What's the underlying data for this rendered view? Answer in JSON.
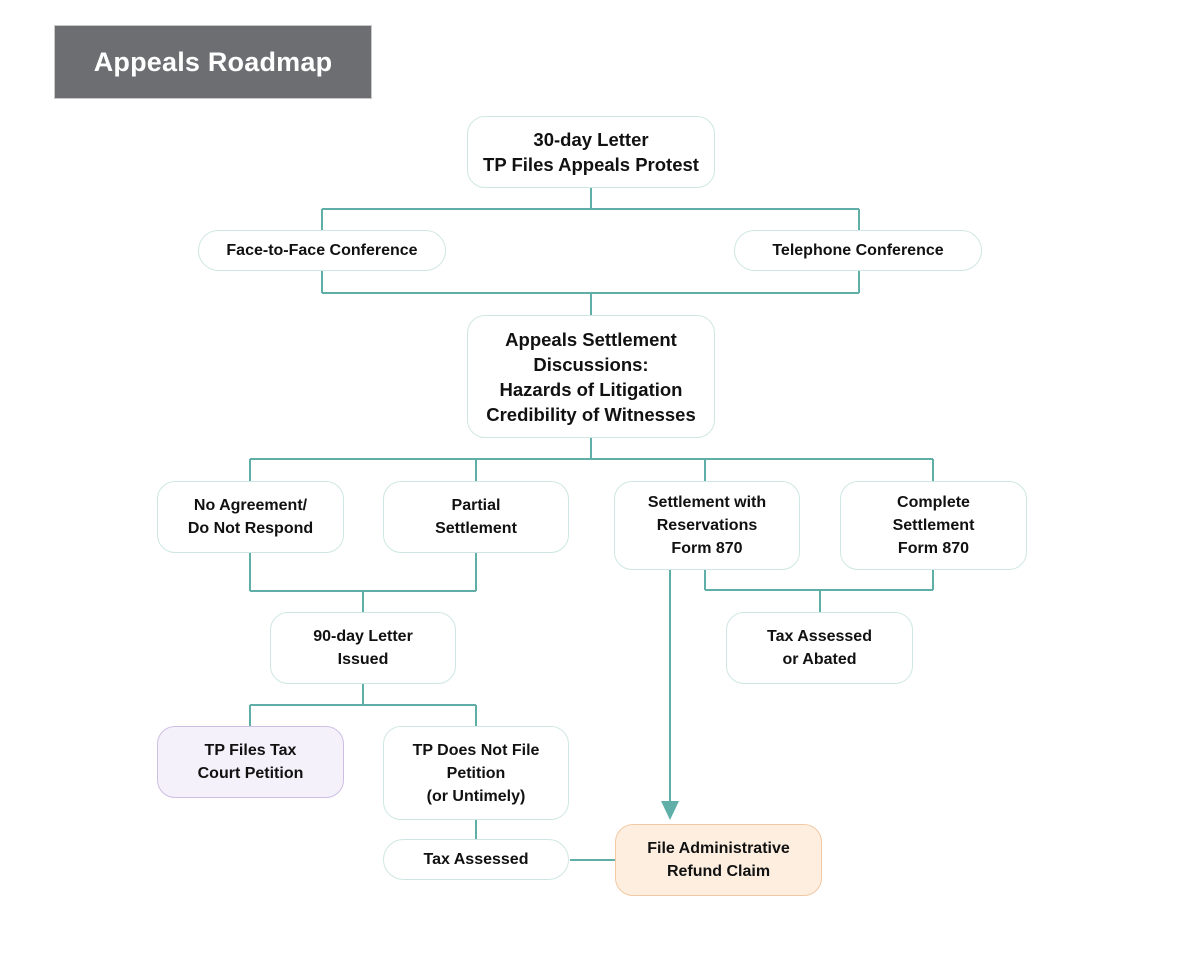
{
  "title": "Appeals Roadmap",
  "colors": {
    "connector": "#5fafa8",
    "node_border": "#cfe7e4",
    "title_bg": "#6d6e71",
    "court_petition_bg": "#f5f1fb",
    "refund_claim_bg": "#fdeee0"
  },
  "nodes": {
    "thirty_day": {
      "lines": [
        "30-day Letter",
        "TP Files Appeals Protest"
      ]
    },
    "face_to_face": {
      "lines": [
        "Face-to-Face Conference"
      ]
    },
    "telephone": {
      "lines": [
        "Telephone Conference"
      ]
    },
    "settlement_discussions": {
      "lines": [
        "Appeals Settlement",
        "Discussions:",
        "Hazards of Litigation",
        "Credibility of Witnesses"
      ]
    },
    "no_agreement": {
      "lines": [
        "No Agreement/",
        "Do Not Respond"
      ]
    },
    "partial_settlement": {
      "lines": [
        "Partial",
        "Settlement"
      ]
    },
    "settlement_reservations": {
      "lines": [
        "Settlement with",
        "Reservations",
        "Form 870"
      ]
    },
    "complete_settlement": {
      "lines": [
        "Complete",
        "Settlement",
        "Form 870"
      ]
    },
    "ninety_day": {
      "lines": [
        "90-day Letter",
        "Issued"
      ]
    },
    "tax_assessed_abated": {
      "lines": [
        "Tax Assessed",
        "or Abated"
      ]
    },
    "tax_court_petition": {
      "lines": [
        "TP Files Tax",
        "Court Petition"
      ]
    },
    "no_petition": {
      "lines": [
        "TP Does Not File",
        "Petition",
        "(or Untimely)"
      ]
    },
    "tax_assessed": {
      "lines": [
        "Tax Assessed"
      ]
    },
    "refund_claim": {
      "lines": [
        "File Administrative",
        "Refund Claim"
      ]
    }
  }
}
